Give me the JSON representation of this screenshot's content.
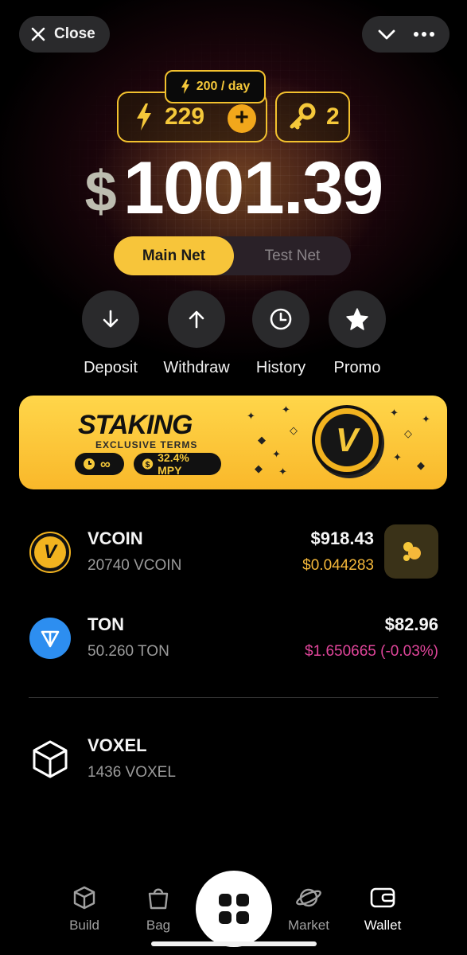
{
  "topbar": {
    "close_label": "Close",
    "close_icon": "close-icon",
    "chevron_icon": "chevron-down-icon",
    "more_icon": "more-icon"
  },
  "energy": {
    "value": "229",
    "rate": "200 / day",
    "plus": "+"
  },
  "keys": {
    "value": "2"
  },
  "balance": {
    "currency": "$",
    "amount": "1001.39"
  },
  "network": {
    "main": "Main Net",
    "test": "Test Net",
    "selected": "Main Net"
  },
  "actions": [
    {
      "label": "Deposit",
      "icon": "arrow-down-icon"
    },
    {
      "label": "Withdraw",
      "icon": "arrow-up-icon"
    },
    {
      "label": "History",
      "icon": "clock-icon"
    },
    {
      "label": "Promo",
      "icon": "star-icon"
    }
  ],
  "banner": {
    "title": "STAKING",
    "subtitle": "EXCLUSIVE TERMS",
    "chip_duration": "∞",
    "chip_rate": "32.4% MPY",
    "coin_letter": "V"
  },
  "assets": [
    {
      "name": "VCOIN",
      "quantity": "20740 VCOIN",
      "usd": "$918.43",
      "price": "$0.044283",
      "price_color": "#f5b83a"
    },
    {
      "name": "TON",
      "quantity": "50.260 TON",
      "usd": "$82.96",
      "price": "$1.650665 (-0.03%)",
      "price_color": "#e0459a"
    },
    {
      "name": "VOXEL",
      "quantity": "1436 VOXEL"
    }
  ],
  "nav": [
    {
      "label": "Build",
      "icon": "cube-icon"
    },
    {
      "label": "Bag",
      "icon": "bag-icon"
    },
    {
      "label": "",
      "icon": "grid-icon"
    },
    {
      "label": "Market",
      "icon": "planet-icon"
    },
    {
      "label": "Wallet",
      "icon": "wallet-icon",
      "active": true
    }
  ],
  "colors": {
    "accent": "#f7c53a",
    "background": "#000000",
    "pill": "#2a2a2c",
    "negative": "#e0459a"
  }
}
